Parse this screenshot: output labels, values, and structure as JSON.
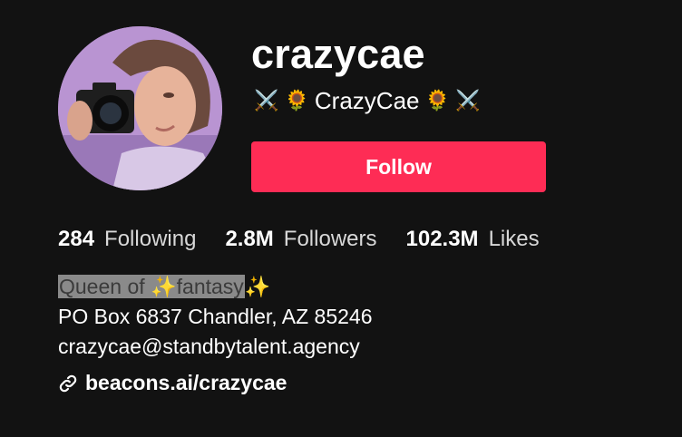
{
  "profile": {
    "username": "crazycae",
    "nickname": "CrazyCae",
    "nickname_left_emojis": "⚔️ 🌻",
    "nickname_right_emojis": "🌻 ⚔️",
    "follow_label": "Follow"
  },
  "stats": {
    "following_count": "284",
    "following_label": "Following",
    "followers_count": "2.8M",
    "followers_label": "Followers",
    "likes_count": "102.3M",
    "likes_label": "Likes"
  },
  "bio": {
    "line1_highlighted": "Queen of ✨fantasy",
    "line1_tail": "✨",
    "line2": "PO Box 6837 Chandler, AZ 85246",
    "line3": "crazycae@standbytalent.agency"
  },
  "link": {
    "text": "beacons.ai/crazycae",
    "icon": "link-icon"
  },
  "colors": {
    "background": "#121212",
    "follow_button": "#fe2c55",
    "text_primary": "#ffffff",
    "text_secondary": "#d8d8d8",
    "selection_highlight": "#8a8a8a"
  }
}
